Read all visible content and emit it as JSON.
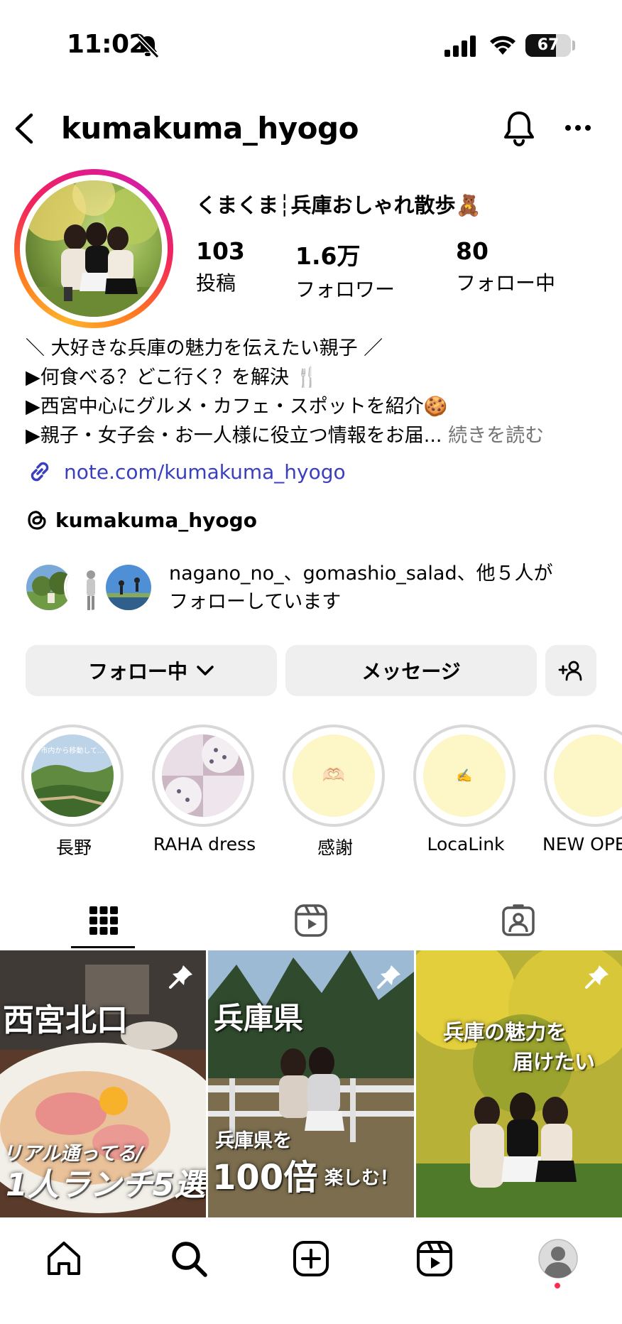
{
  "status_bar": {
    "time": "11:02",
    "battery": "67",
    "battery_level": 0.67
  },
  "header": {
    "username": "kumakuma_hyogo"
  },
  "profile": {
    "display_name": "くまくま┆兵庫おしゃれ散歩🧸",
    "stats": [
      {
        "value": "103",
        "label": "投稿"
      },
      {
        "value": "1.6万",
        "label": "フォロワー"
      },
      {
        "value": "80",
        "label": "フォロー中"
      }
    ],
    "bio": [
      "＼ 大好きな兵庫の魅力を伝えたい親子 ／",
      "▶︎何食べる？どこ行く？を解決 🍴",
      "▶︎西宮中心にグルメ・カフェ・スポットを紹介🍪",
      "▶︎親子・女子会・お一人様に役立つ情報をお届..."
    ],
    "read_more": "続きを読む",
    "link": "note.com/kumakuma_hyogo",
    "threads": "kumakuma_hyogo",
    "followed_by_line1": "nagano_no_、gomashio_salad、他５人が",
    "followed_by_line2": "フォローしています"
  },
  "buttons": {
    "following": "フォロー中",
    "message": "メッセージ"
  },
  "highlights": [
    {
      "label": "長野",
      "overlay": "市内から移動して..."
    },
    {
      "label": "RAHA dress"
    },
    {
      "label": "感謝",
      "emoji": "🫶🏻"
    },
    {
      "label": "LocaLink",
      "emoji": "✍️"
    },
    {
      "label": "NEW OPEN"
    }
  ],
  "posts": [
    {
      "title": "西宮北口",
      "subtitle": "リアル通ってる/",
      "big": "1人ランチ5選"
    },
    {
      "title": "兵庫県",
      "subtitle": "兵庫県を",
      "big": "100倍",
      "tail": "楽しむ！"
    },
    {
      "title_line1": "兵庫の魅力を",
      "title_line2": "届けたい"
    }
  ]
}
